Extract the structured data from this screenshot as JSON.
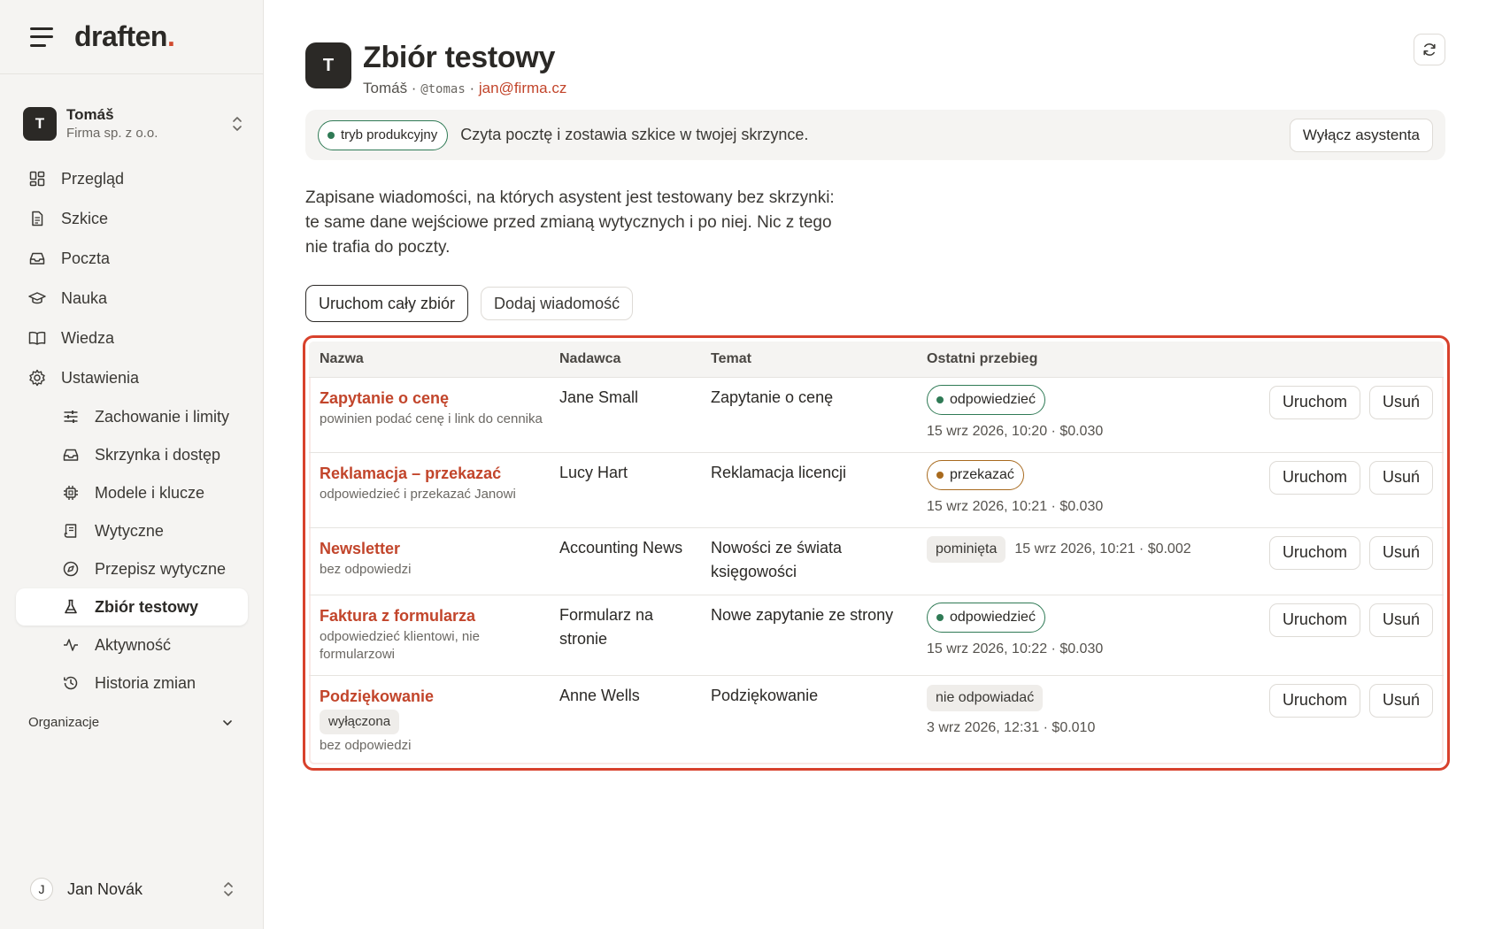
{
  "brand": {
    "logo_text": "draften",
    "logo_dot": "."
  },
  "account": {
    "initial": "T",
    "name": "Tomáš",
    "org": "Firma sp. z o.o."
  },
  "nav": {
    "overview": "Przegląd",
    "drafts": "Szkice",
    "mail": "Poczta",
    "learning": "Nauka",
    "knowledge": "Wiedza",
    "settings": "Ustawienia",
    "behavior": "Zachowanie i limity",
    "mailbox": "Skrzynka i dostęp",
    "models": "Modele i klucze",
    "guidelines": "Wytyczne",
    "rewrite": "Przepisz wytyczne",
    "testset": "Zbiór testowy",
    "activity": "Aktywność",
    "history": "Historia zmian"
  },
  "org_section": {
    "label": "Organizacje"
  },
  "user": {
    "initial": "J",
    "name": "Jan Novák"
  },
  "header": {
    "initial": "T",
    "title": "Zbiór testowy",
    "name": "Tomáš",
    "sep1": " · ",
    "handle": "@tomas",
    "sep2": " · ",
    "email": "jan@firma.cz"
  },
  "banner": {
    "mode": "tryb produkcyjny",
    "text": "Czyta pocztę i zostawia szkice w twojej skrzynce.",
    "disable_label": "Wyłącz asystenta"
  },
  "description": {
    "line1": "Zapisane wiadomości, na których asystent jest testowany bez skrzynki:",
    "line2": "te same dane wejściowe przed zmianą wytycznych i po niej. Nic z tego",
    "line3": "nie trafia do poczty."
  },
  "actions": {
    "run_all": "Uruchom cały zbiór",
    "add_message": "Dodaj wiadomość"
  },
  "table": {
    "headers": {
      "name": "Nazwa",
      "sender": "Nadawca",
      "subject": "Temat",
      "last_run": "Ostatni przebieg"
    },
    "run_label": "Uruchom",
    "delete_label": "Usuń",
    "rows": [
      {
        "name": "Zapytanie o cenę",
        "expect": "powinien podać cenę i link do cennika",
        "sender": "Jane Small",
        "subject": "Zapytanie o cenę",
        "status": "odpowiedzieć",
        "meta": "15 wrz 2026, 10:20 · $0.030"
      },
      {
        "name": "Reklamacja – przekazać",
        "expect": "odpowiedzieć i przekazać Janowi",
        "sender": "Lucy Hart",
        "subject": "Reklamacja licencji",
        "status": "przekazać",
        "meta": "15 wrz 2026, 10:21 · $0.030"
      },
      {
        "name": "Newsletter",
        "expect": "bez odpowiedzi",
        "sender": "Accounting News",
        "subject": "Nowości ze świata księgowości",
        "status": "pominięta",
        "meta": "15 wrz 2026, 10:21 · $0.002"
      },
      {
        "name": "Faktura z formularza",
        "expect": "odpowiedzieć klientowi, nie formularzowi",
        "sender": "Formularz na stronie",
        "subject": "Nowe zapytanie ze strony",
        "status": "odpowiedzieć",
        "meta": "15 wrz 2026, 10:22 · $0.030"
      },
      {
        "name": "Podziękowanie",
        "tag": "wyłączona",
        "expect": "bez odpowiedzi",
        "sender": "Anne Wells",
        "subject": "Podziękowanie",
        "status": "nie odpowiadać",
        "meta": "3 wrz 2026, 12:31 · $0.010"
      }
    ]
  },
  "colors": {
    "accent": "#c2452b",
    "highlight_border": "#d8412c",
    "green": "#2f7a55",
    "amber": "#a86a1e",
    "dark": "#2b2926"
  }
}
